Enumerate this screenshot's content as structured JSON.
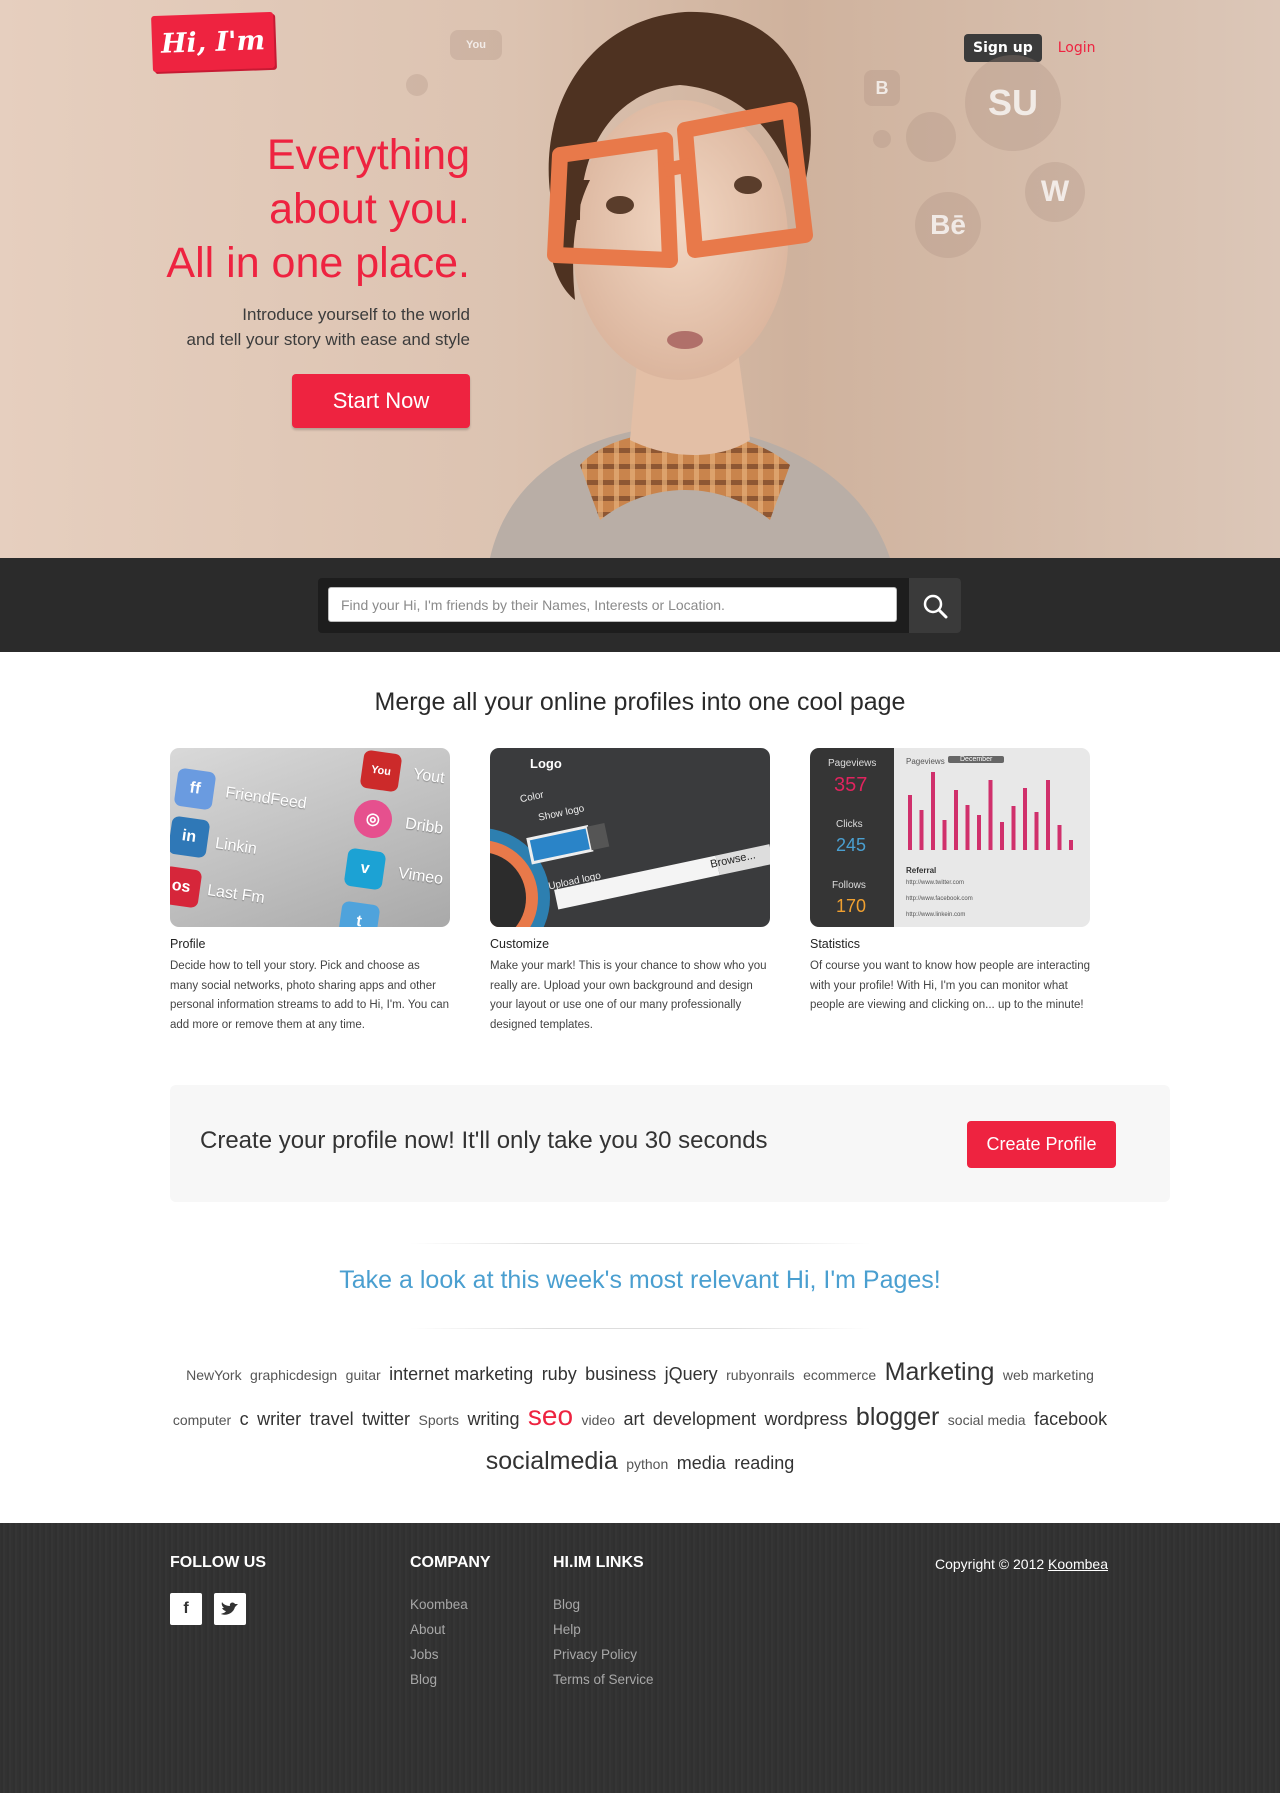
{
  "brand": {
    "logo_text": "Hi, I'm"
  },
  "nav": {
    "signup_label": "Sign up",
    "login_label": "Login"
  },
  "hero": {
    "headline_line1": "Everything",
    "headline_line2": "about you.",
    "headline_line3": "All in one place.",
    "sub_line1": "Introduce yourself to the world",
    "sub_line2": "and tell your story with ease and style",
    "cta_label": "Start Now"
  },
  "search": {
    "placeholder": "Find your Hi, I'm friends by their Names, Interests or Location.",
    "button_icon": "search-icon"
  },
  "features": {
    "title": "Merge all your online profiles into one cool page",
    "items": [
      {
        "title": "Profile",
        "description": "Decide how to tell your story. Pick and choose as many social networks, photo sharing apps and other personal information streams to add to Hi, I'm. You can add more or remove them at any time.",
        "thumb_left_labels": [
          "FriendFeed",
          "Linkin",
          "Last Fm"
        ],
        "thumb_right_labels": [
          "Yout",
          "Dribb",
          "Vimeo"
        ]
      },
      {
        "title": "Customize",
        "description": "Make your mark! This is your chance to show who you really are. Upload your own background and design your layout or use one of our many professionally designed templates.",
        "thumb_heading": "Logo",
        "thumb_color_label": "Color",
        "thumb_show_logo": "Show logo",
        "thumb_upload_label": "Upload logo",
        "thumb_browse": "Browse..."
      },
      {
        "title": "Statistics",
        "description": "Of course you want to know how people are interacting with your profile! With Hi, I'm you can monitor what people are viewing and clicking on... up to the minute!",
        "stats": [
          {
            "label": "Pageviews",
            "value": "357",
            "color": "#e0245e"
          },
          {
            "label": "Clicks",
            "value": "245",
            "color": "#4a9fd0"
          },
          {
            "label": "Follows",
            "value": "170",
            "color": "#f0a030"
          }
        ],
        "chart_label": "Pageviews",
        "chart_month": "December",
        "referral_label": "Referral",
        "referrals": [
          "http://www.twitter.com",
          "http://www.facebook.com",
          "http://www.linkein.com"
        ]
      }
    ]
  },
  "cta": {
    "text": "Create your profile now! It'll only take you 30 seconds",
    "button_label": "Create Profile"
  },
  "relevant": {
    "title": "Take a look at this week's most relevant Hi, I'm Pages!"
  },
  "tags": [
    {
      "text": "NewYork",
      "size": 14,
      "color": "#555"
    },
    {
      "text": "graphicdesign",
      "size": 14,
      "color": "#555"
    },
    {
      "text": "guitar",
      "size": 14,
      "color": "#555"
    },
    {
      "text": "internet marketing",
      "size": 18,
      "color": "#333"
    },
    {
      "text": "ruby",
      "size": 18,
      "color": "#333"
    },
    {
      "text": "business",
      "size": 18,
      "color": "#333"
    },
    {
      "text": "jQuery",
      "size": 18,
      "color": "#333"
    },
    {
      "text": "rubyonrails",
      "size": 14,
      "color": "#555"
    },
    {
      "text": "ecommerce",
      "size": 14,
      "color": "#555"
    },
    {
      "text": "Marketing",
      "size": 25,
      "color": "#333"
    },
    {
      "text": "web marketing",
      "size": 14,
      "color": "#555"
    },
    {
      "text": "computer",
      "size": 14,
      "color": "#555"
    },
    {
      "text": "c",
      "size": 18,
      "color": "#333"
    },
    {
      "text": "writer",
      "size": 18,
      "color": "#333"
    },
    {
      "text": "travel",
      "size": 18,
      "color": "#333"
    },
    {
      "text": "twitter",
      "size": 18,
      "color": "#333"
    },
    {
      "text": "Sports",
      "size": 14,
      "color": "#555"
    },
    {
      "text": "writing",
      "size": 18,
      "color": "#333"
    },
    {
      "text": "seo",
      "size": 28,
      "color": "#ee2340"
    },
    {
      "text": "video",
      "size": 14,
      "color": "#555"
    },
    {
      "text": "art",
      "size": 18,
      "color": "#333"
    },
    {
      "text": "development",
      "size": 18,
      "color": "#333"
    },
    {
      "text": "wordpress",
      "size": 18,
      "color": "#333"
    },
    {
      "text": "blogger",
      "size": 25,
      "color": "#333"
    },
    {
      "text": "social media",
      "size": 14,
      "color": "#555"
    },
    {
      "text": "facebook",
      "size": 18,
      "color": "#333"
    },
    {
      "text": "socialmedia",
      "size": 25,
      "color": "#333"
    },
    {
      "text": "python",
      "size": 14,
      "color": "#555"
    },
    {
      "text": "media",
      "size": 18,
      "color": "#333"
    },
    {
      "text": "reading",
      "size": 18,
      "color": "#333"
    }
  ],
  "footer": {
    "follow_heading": "FOLLOW US",
    "company_heading": "COMPANY",
    "company_links": [
      "Koombea",
      "About",
      "Jobs",
      "Blog"
    ],
    "himlinks_heading": "HI.IM LINKS",
    "himlinks": [
      "Blog",
      "Help",
      "Privacy Policy",
      "Terms of Service"
    ],
    "copyright_prefix": "Copyright © 2012",
    "copyright_link": "Koombea",
    "social_icons": [
      "facebook-icon",
      "twitter-icon"
    ]
  },
  "colors": {
    "brand_red": "#ee2340",
    "accent_blue": "#4a9fd0",
    "dark_band": "#2b2b2b"
  }
}
